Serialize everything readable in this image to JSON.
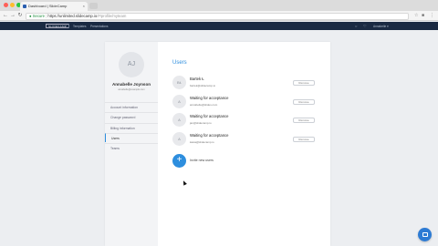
{
  "browser": {
    "tab_title": "Dashboard | SlideCamp",
    "tab_close": "×",
    "security_label": "Secure",
    "url_host": "https://unlimited.slidecamp.io",
    "url_path": "/#!profile/myteam",
    "icons": [
      "back-icon",
      "forward-icon",
      "reload-icon",
      "lock-icon",
      "star-icon",
      "extension-icon",
      "menu-icon"
    ],
    "traffic_colors": [
      "#ff5f57",
      "#febc2e",
      "#28c840"
    ]
  },
  "app_nav": {
    "brand": "SLIDECAMP",
    "links": [
      "Templates",
      "Presentations"
    ],
    "account": "Annabelle"
  },
  "profile": {
    "initials": "AJ",
    "name": "Annabelle Joynson",
    "email": "annabelle@example.com"
  },
  "sidebar": {
    "items": [
      {
        "label": "Account information"
      },
      {
        "label": "Change password"
      },
      {
        "label": "Billing information"
      },
      {
        "label": "Users"
      },
      {
        "label": "Teams"
      }
    ],
    "active_index": 3
  },
  "users": {
    "title": "Users",
    "rows": [
      {
        "initials": "BŁ",
        "name": "Bartek Ł",
        "email": "bartek@slidecamp.io",
        "action": "Remove"
      },
      {
        "initials": "A",
        "name": "Waiting for acceptance",
        "email": "annabelle@slides.com",
        "action": "Remove"
      },
      {
        "initials": "A",
        "name": "Waiting for acceptance",
        "email": "jan@slidecamp.io",
        "action": "Remove"
      },
      {
        "initials": "A",
        "name": "Waiting for acceptance",
        "email": "kasia@slidecamp.io",
        "action": "Remove"
      }
    ],
    "invite_icon": "+",
    "invite_label": "Invite new users"
  },
  "colors": {
    "accent": "#2d8ede",
    "nav_bg": "#1a2a42",
    "chat": "#2d7bd4"
  }
}
